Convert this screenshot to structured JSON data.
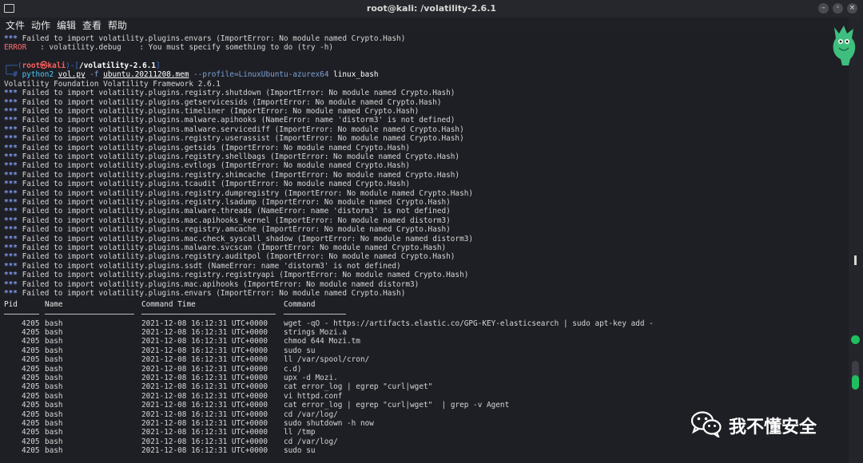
{
  "window": {
    "title": "root@kali: /volatility-2.6.1",
    "buttons": [
      "minimize",
      "maximize",
      "close"
    ]
  },
  "menu": [
    "文件",
    "动作",
    "编辑",
    "查看",
    "帮助"
  ],
  "terminal": {
    "pre_lines": [
      {
        "mark": "*** ",
        "text": "Failed to import volatility.plugins.envars (ImportError: No module named Crypto.Hash)"
      },
      {
        "label": "ERROR",
        "text": "   : volatility.debug    : You must specify something to do (try -h)"
      }
    ],
    "prompt": {
      "top_left": "┌──(",
      "user": "root㉿kali",
      "middle": ")-[",
      "path": "/volatility-2.6.1",
      "end": "]",
      "bottom_left": "└─# ",
      "cmd_name": "python2",
      "cmd_script": "vol.py",
      "cmd_flag": "-f",
      "cmd_file": "ubuntu.20211208.mem",
      "cmd_profile": "--profile=LinuxUbuntu-azurex64",
      "cmd_plugin": "linux_bash"
    },
    "banner": "Volatility Foundation Volatility Framework 2.6.1",
    "errors": [
      {
        "mark": "*** ",
        "text": "Failed to import volatility.plugins.registry.shutdown (ImportError: No module named Crypto.Hash)"
      },
      {
        "mark": "*** ",
        "text": "Failed to import volatility.plugins.getservicesids (ImportError: No module named Crypto.Hash)"
      },
      {
        "mark": "*** ",
        "text": "Failed to import volatility.plugins.timeliner (ImportError: No module named Crypto.Hash)"
      },
      {
        "mark": "*** ",
        "text": "Failed to import volatility.plugins.malware.apihooks (NameError: name 'distorm3' is not defined)"
      },
      {
        "mark": "*** ",
        "text": "Failed to import volatility.plugins.malware.servicediff (ImportError: No module named Crypto.Hash)"
      },
      {
        "mark": "*** ",
        "text": "Failed to import volatility.plugins.registry.userassist (ImportError: No module named Crypto.Hash)"
      },
      {
        "mark": "*** ",
        "text": "Failed to import volatility.plugins.getsids (ImportError: No module named Crypto.Hash)"
      },
      {
        "mark": "*** ",
        "text": "Failed to import volatility.plugins.registry.shellbags (ImportError: No module named Crypto.Hash)"
      },
      {
        "mark": "*** ",
        "text": "Failed to import volatility.plugins.evtlogs (ImportError: No module named Crypto.Hash)"
      },
      {
        "mark": "*** ",
        "text": "Failed to import volatility.plugins.registry.shimcache (ImportError: No module named Crypto.Hash)"
      },
      {
        "mark": "*** ",
        "text": "Failed to import volatility.plugins.tcaudit (ImportError: No module named Crypto.Hash)"
      },
      {
        "mark": "*** ",
        "text": "Failed to import volatility.plugins.registry.dumpregistry (ImportError: No module named Crypto.Hash)"
      },
      {
        "mark": "*** ",
        "text": "Failed to import volatility.plugins.registry.lsadump (ImportError: No module named Crypto.Hash)"
      },
      {
        "mark": "*** ",
        "text": "Failed to import volatility.plugins.malware.threads (NameError: name 'distorm3' is not defined)"
      },
      {
        "mark": "*** ",
        "text": "Failed to import volatility.plugins.mac.apihooks_kernel (ImportError: No module named distorm3)"
      },
      {
        "mark": "*** ",
        "text": "Failed to import volatility.plugins.registry.amcache (ImportError: No module named Crypto.Hash)"
      },
      {
        "mark": "*** ",
        "text": "Failed to import volatility.plugins.mac.check_syscall_shadow (ImportError: No module named distorm3)"
      },
      {
        "mark": "*** ",
        "text": "Failed to import volatility.plugins.malware.svcscan (ImportError: No module named Crypto.Hash)"
      },
      {
        "mark": "*** ",
        "text": "Failed to import volatility.plugins.registry.auditpol (ImportError: No module named Crypto.Hash)"
      },
      {
        "mark": "*** ",
        "text": "Failed to import volatility.plugins.ssdt (NameError: name 'distorm3' is not defined)"
      },
      {
        "mark": "*** ",
        "text": "Failed to import volatility.plugins.registry.registryapi (ImportError: No module named Crypto.Hash)"
      },
      {
        "mark": "*** ",
        "text": "Failed to import volatility.plugins.mac.apihooks (ImportError: No module named distorm3)"
      },
      {
        "mark": "*** ",
        "text": "Failed to import volatility.plugins.envars (ImportError: No module named Crypto.Hash)"
      }
    ],
    "table": {
      "headers": {
        "pid": "Pid",
        "name": "Name",
        "time": "Command Time",
        "command": "Command"
      },
      "rows": [
        {
          "pid": "4205",
          "name": "bash",
          "time": "2021-12-08 16:12:31 UTC+0000",
          "command": "wget -qO - https://artifacts.elastic.co/GPG-KEY-elasticsearch | sudo apt-key add -"
        },
        {
          "pid": "4205",
          "name": "bash",
          "time": "2021-12-08 16:12:31 UTC+0000",
          "command": "strings Mozi.a"
        },
        {
          "pid": "4205",
          "name": "bash",
          "time": "2021-12-08 16:12:31 UTC+0000",
          "command": "chmod 644 Mozi.tm"
        },
        {
          "pid": "4205",
          "name": "bash",
          "time": "2021-12-08 16:12:31 UTC+0000",
          "command": "sudo su"
        },
        {
          "pid": "4205",
          "name": "bash",
          "time": "2021-12-08 16:12:31 UTC+0000",
          "command": "ll /var/spool/cron/"
        },
        {
          "pid": "4205",
          "name": "bash",
          "time": "2021-12-08 16:12:31 UTC+0000",
          "command": "c.d)"
        },
        {
          "pid": "4205",
          "name": "bash",
          "time": "2021-12-08 16:12:31 UTC+0000",
          "command": "upx -d Mozi."
        },
        {
          "pid": "4205",
          "name": "bash",
          "time": "2021-12-08 16:12:31 UTC+0000",
          "command": "cat error_log | egrep \"curl|wget\""
        },
        {
          "pid": "4205",
          "name": "bash",
          "time": "2021-12-08 16:12:31 UTC+0000",
          "command": "vi httpd.conf"
        },
        {
          "pid": "4205",
          "name": "bash",
          "time": "2021-12-08 16:12:31 UTC+0000",
          "command": "cat error_log | egrep \"curl|wget\"  | grep -v Agent"
        },
        {
          "pid": "4205",
          "name": "bash",
          "time": "2021-12-08 16:12:31 UTC+0000",
          "command": "cd /var/log/"
        },
        {
          "pid": "4205",
          "name": "bash",
          "time": "2021-12-08 16:12:31 UTC+0000",
          "command": "sudo shutdown -h now"
        },
        {
          "pid": "4205",
          "name": "bash",
          "time": "2021-12-08 16:12:31 UTC+0000",
          "command": "ll /tmp"
        },
        {
          "pid": "4205",
          "name": "bash",
          "time": "2021-12-08 16:12:31 UTC+0000",
          "command": "cd /var/log/"
        },
        {
          "pid": "4205",
          "name": "bash",
          "time": "2021-12-08 16:12:31 UTC+0000",
          "command": "sudo su"
        }
      ]
    }
  },
  "watermark": {
    "text": "我不懂安全",
    "icon": "wechat-icon"
  },
  "colors": {
    "error_mark": "#7f9cf0",
    "error_label": "#ff6e6e",
    "prompt_user": "#ff5f5f",
    "command": "#4fc9ff",
    "accent_green": "#1fbf5f"
  }
}
